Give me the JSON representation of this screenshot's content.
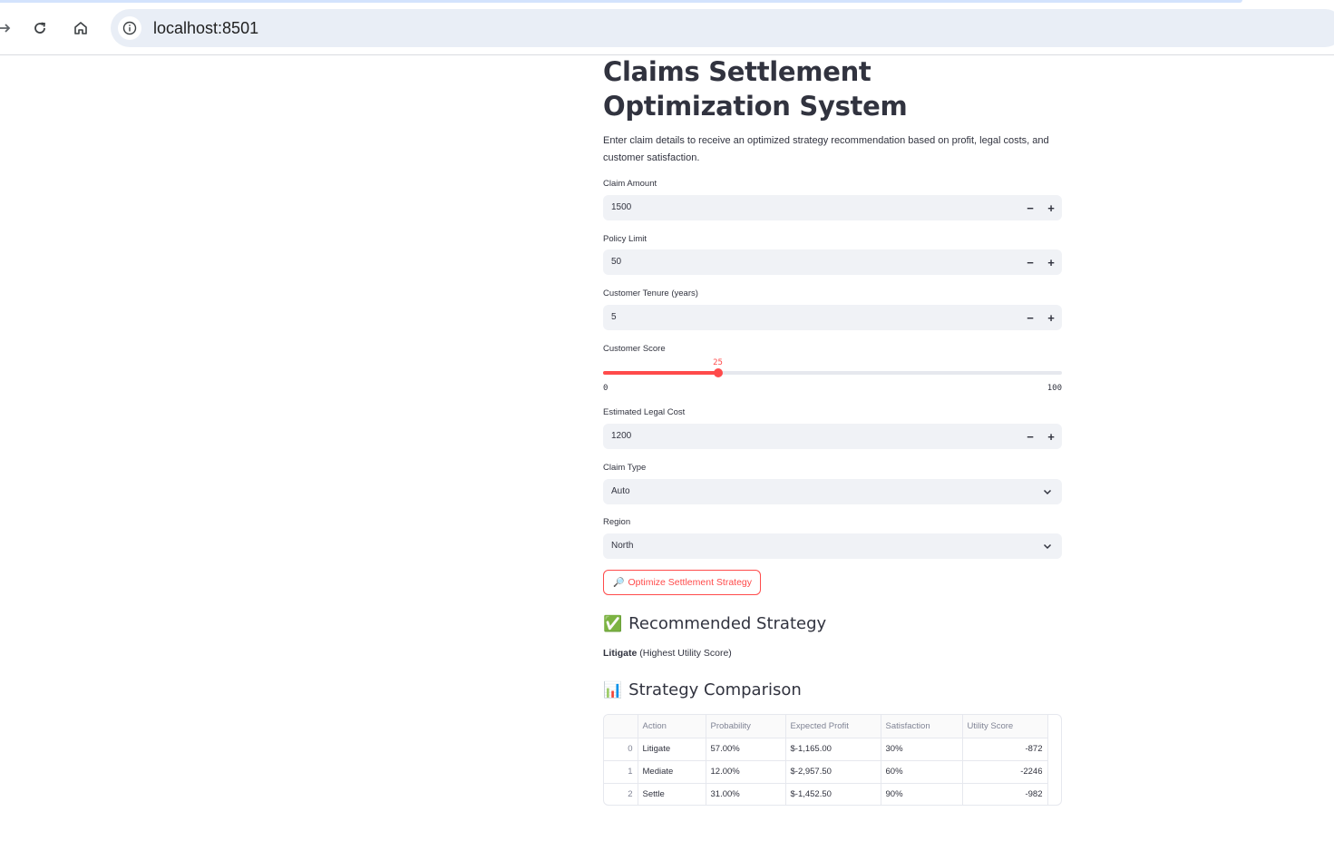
{
  "browser": {
    "url": "localhost:8501"
  },
  "page": {
    "title": "Claims Settlement Optimization System",
    "description": "Enter claim details to receive an optimized strategy recommendation based on profit, legal costs, and customer satisfaction."
  },
  "form": {
    "claim_amount": {
      "label": "Claim Amount",
      "value": "1500"
    },
    "policy_limit": {
      "label": "Policy Limit",
      "value": "50"
    },
    "customer_tenure": {
      "label": "Customer Tenure (years)",
      "value": "5"
    },
    "customer_score": {
      "label": "Customer Score",
      "value": 25,
      "value_label": "25",
      "min": 0,
      "max": 100,
      "min_label": "0",
      "max_label": "100"
    },
    "legal_cost": {
      "label": "Estimated Legal Cost",
      "value": "1200"
    },
    "claim_type": {
      "label": "Claim Type",
      "value": "Auto"
    },
    "region": {
      "label": "Region",
      "value": "North"
    },
    "stepper_minus": "−",
    "stepper_plus": "+",
    "optimize_button": {
      "icon": "🔎",
      "label": "Optimize Settlement Strategy"
    }
  },
  "recommendation": {
    "icon": "✅",
    "heading": "Recommended Strategy",
    "action": "Litigate",
    "note": "(Highest Utility Score)"
  },
  "comparison": {
    "icon": "📊",
    "heading": "Strategy Comparison",
    "columns": [
      "",
      "Action",
      "Probability",
      "Expected Profit",
      "Satisfaction",
      "Utility Score"
    ],
    "rows": [
      [
        "0",
        "Litigate",
        "57.00%",
        "$-1,165.00",
        "30%",
        "-872"
      ],
      [
        "1",
        "Mediate",
        "12.00%",
        "$-2,957.50",
        "60%",
        "-2246"
      ],
      [
        "2",
        "Settle",
        "31.00%",
        "$-1,452.50",
        "90%",
        "-982"
      ]
    ]
  },
  "colors": {
    "primary": "#ff4b4b",
    "input_bg": "#f0f2f6",
    "text": "#31333f"
  }
}
